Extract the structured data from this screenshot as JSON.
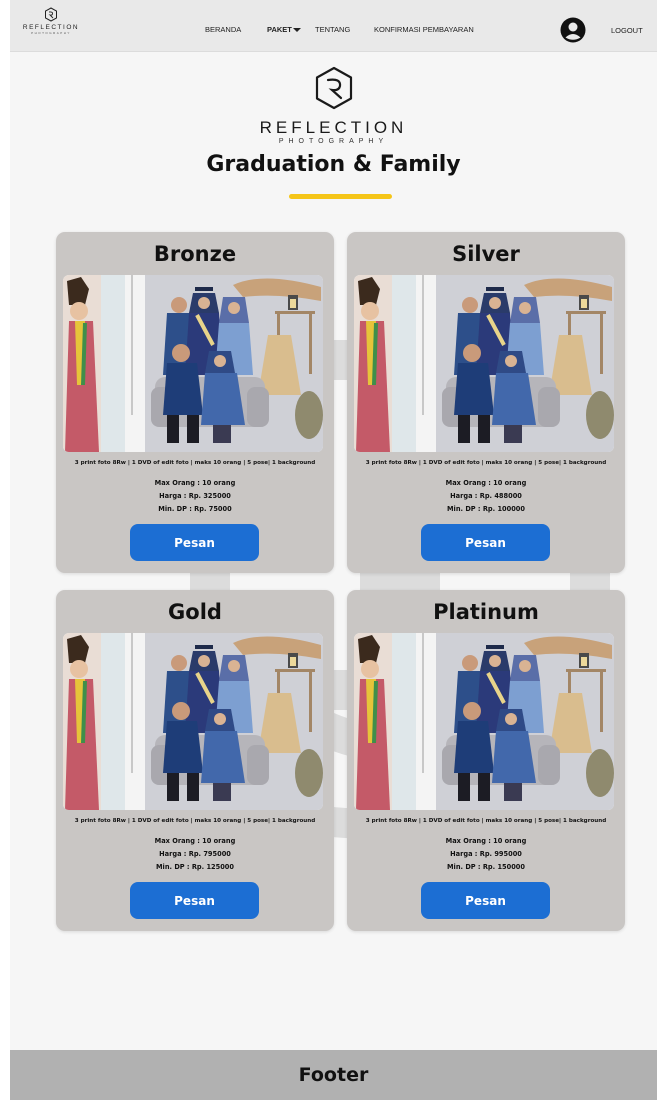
{
  "navbar": {
    "logo": {
      "brand": "REFLECTION",
      "sub": "PHOTOGRAPHY"
    },
    "links": [
      "BERANDA",
      "PAKET",
      "TENTANG",
      "KONFIRMASI PEMBAYARAN"
    ],
    "active_link": "PAKET",
    "logout": "LOGOUT"
  },
  "hero": {
    "brand": "REFLECTION",
    "sub": "PHOTOGRAPHY",
    "title": "Graduation & Family",
    "accent_color": "#f5c518"
  },
  "packages": [
    {
      "name": "Bronze",
      "description": "3 print foto 8Rw | 1 DVD of edit foto | maks 10 orang | 5 pose| 1 background",
      "max_people": "Max Orang : 10 orang",
      "price": "Harga : Rp. 325000",
      "min_dp": "Min. DP : Rp. 75000",
      "button": "Pesan"
    },
    {
      "name": "Silver",
      "description": "3 print foto 8Rw | 1 DVD of edit foto | maks 10 orang | 5 pose| 1 background",
      "max_people": "Max Orang : 10 orang",
      "price": "Harga : Rp. 488000",
      "min_dp": "Min. DP : Rp. 100000",
      "button": "Pesan"
    },
    {
      "name": "Gold",
      "description": "3 print foto 8Rw | 1 DVD of edit foto | maks 10 orang | 5 pose| 1 background",
      "max_people": "Max Orang : 10 orang",
      "price": "Harga : Rp. 795000",
      "min_dp": "Min. DP : Rp. 125000",
      "button": "Pesan"
    },
    {
      "name": "Platinum",
      "description": "3 print foto 8Rw | 1 DVD of edit foto | maks 10 orang | 5 pose| 1 background",
      "max_people": "Max Orang : 10 orang",
      "price": "Harga : Rp. 995000",
      "min_dp": "Min. DP : Rp. 150000",
      "button": "Pesan"
    }
  ],
  "colors": {
    "card_bg": "#c9c6c4",
    "button": "#1c6ed3",
    "footer": "#b1b1b1"
  },
  "footer": {
    "label": "Footer"
  }
}
